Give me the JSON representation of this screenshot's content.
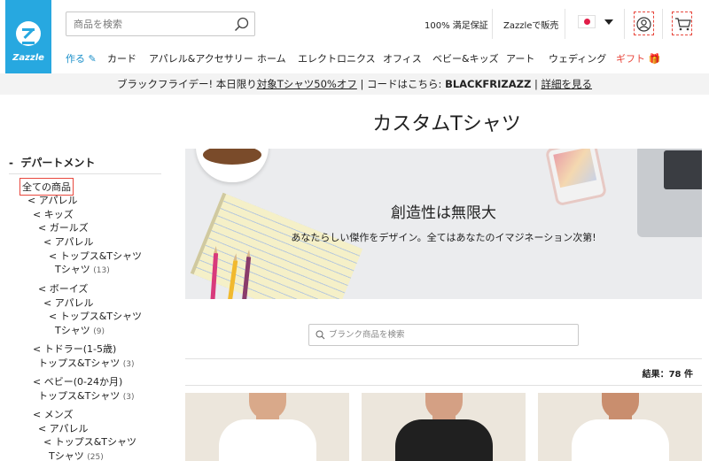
{
  "header": {
    "logo_text": "Zazzle",
    "search_placeholder": "商品を検索",
    "satisfaction": "100% 満足保証",
    "sell": "Zazzleで販売",
    "flag": "japan-flag-icon"
  },
  "nav": {
    "create": "作る",
    "items": [
      "カード",
      "アパレル&アクセサリー",
      "ホーム",
      "エレクトロニクス",
      "オフィス",
      "ベビー&キッズ",
      "アート",
      "ウェディング"
    ],
    "gift": "ギフト"
  },
  "promo": {
    "text1": "ブラックフライデー! 本日限り",
    "link1": "対象Tシャツ50%オフ",
    "text2": " | コードはこちら: ",
    "code": "BLACKFRIZAZZ",
    "text3": " | ",
    "link2": "詳細を見る"
  },
  "page_title": "カスタムTシャツ",
  "sidebar": {
    "title": "デパートメント",
    "dash": "-",
    "all": "全ての商品",
    "tree": [
      {
        "label": "< アパレル",
        "count": ""
      },
      {
        "label": "< キッズ",
        "count": ""
      },
      {
        "label": "< ガールズ",
        "count": ""
      },
      {
        "label": "< アパレル",
        "count": ""
      },
      {
        "label": "< トップス&Tシャツ",
        "count": ""
      },
      {
        "label": "Tシャツ",
        "count": "(13)"
      },
      {
        "label": "< ボーイズ",
        "count": ""
      },
      {
        "label": "< アパレル",
        "count": ""
      },
      {
        "label": "< トップス&Tシャツ",
        "count": ""
      },
      {
        "label": "Tシャツ",
        "count": "(9)"
      },
      {
        "label": "< トドラー(1-5歳)",
        "count": ""
      },
      {
        "label": "トップス&Tシャツ",
        "count": "(3)"
      },
      {
        "label": "< ベビー(0-24か月)",
        "count": ""
      },
      {
        "label": "トップス&Tシャツ",
        "count": "(3)"
      },
      {
        "label": "< メンズ",
        "count": ""
      },
      {
        "label": "< アパレル",
        "count": ""
      },
      {
        "label": "< トップス&Tシャツ",
        "count": ""
      },
      {
        "label": "Tシャツ",
        "count": "(25)"
      }
    ]
  },
  "banner": {
    "title": "創造性は無限大",
    "subtitle": "あなたらしい傑作をデザイン。全てはあなたのイマジネーション次第!"
  },
  "blank_search_placeholder": "ブランク商品を検索",
  "results": "結果：78 件",
  "products": [
    {
      "shirt_color": "#ffffff",
      "skin": "#d9a98a"
    },
    {
      "shirt_color": "#202020",
      "skin": "#d4a084"
    },
    {
      "shirt_color": "#ffffff",
      "skin": "#c98e6e"
    }
  ]
}
